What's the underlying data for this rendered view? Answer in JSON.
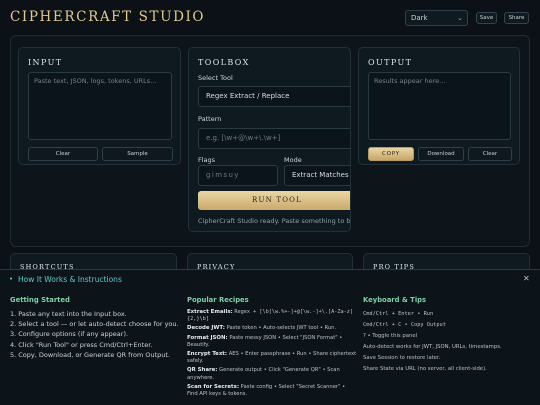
{
  "header": {
    "brand": "CIPHERCRAFT STUDIO",
    "theme": "Dark",
    "save_label": "Save",
    "share_label": "Share"
  },
  "input": {
    "title": "INPUT",
    "placeholder": "Paste text, JSON, logs, tokens, URLs...",
    "clear_label": "Clear",
    "sample_label": "Sample"
  },
  "toolbox": {
    "title": "TOOLBOX",
    "select_tool_label": "Select Tool",
    "selected_tool": "Regex Extract / Replace",
    "pattern_label": "Pattern",
    "pattern_placeholder": "e.g. [\\w+@\\w+\\.\\w+]",
    "flags_label": "Flags",
    "flags_placeholder": "gimsuy",
    "mode_label": "Mode",
    "mode_value": "Extract Matches",
    "run_label": "RUN TOOL",
    "status": "CipherCraft Studio ready. Paste something to begin."
  },
  "output": {
    "title": "OUTPUT",
    "placeholder": "Results appear here...",
    "copy_label": "COPY",
    "download_label": "Download",
    "clear_label": "Clear"
  },
  "cards": {
    "shortcuts": "SHORTCUTS",
    "privacy": "PRIVACY",
    "pro_tips": "PRO TIPS"
  },
  "how": {
    "title": "How It Works & Instructions",
    "getting_started": {
      "heading": "Getting Started",
      "steps": [
        "1. Paste any text into the Input box.",
        "2. Select a tool — or let auto-detect choose for you.",
        "3. Configure options (if any appear).",
        "4. Click \"Run Tool\" or press Cmd/Ctrl+Enter.",
        "5. Copy, Download, or Generate QR from Output."
      ]
    },
    "recipes": {
      "heading": "Popular Recipes",
      "items": [
        {
          "name": "Extract Emails:",
          "text": "Regex + [\\b[\\w.%+-]+@[\\w.-]+\\.[A-Za-z]{2,}\\b]"
        },
        {
          "name": "Decode JWT:",
          "text": "Paste token • Auto-selects JWT tool • Run."
        },
        {
          "name": "Format JSON:",
          "text": "Paste messy JSON • Select \"JSON Format\" • Beautify."
        },
        {
          "name": "Encrypt Text:",
          "text": "AES • Enter passphrase • Run • Share ciphertext safely."
        },
        {
          "name": "QR Share:",
          "text": "Generate output • Click \"Generate QR\" • Scan anywhere."
        },
        {
          "name": "Scan for Secrets:",
          "text": "Paste config • Select \"Secret Scanner\" • Find API keys & tokens."
        }
      ]
    },
    "tips": {
      "heading": "Keyboard & Tips",
      "items": [
        "Cmd/Ctrl + Enter • Run",
        "Cmd/Ctrl + C • Copy Output",
        "? • Toggle this panel",
        "Auto-detect works for JWT, JSON, URLs, timestamps.",
        "Save Session to restore later.",
        "Share State via URL (no server, all client-side)."
      ]
    }
  }
}
